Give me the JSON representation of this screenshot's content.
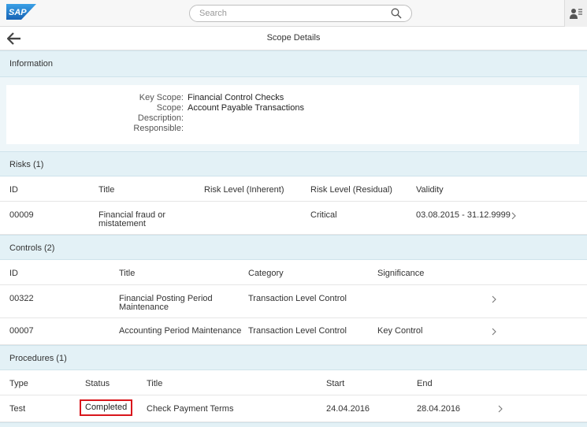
{
  "shell": {
    "logo_text": "SAP",
    "search_placeholder": "Search",
    "colors": {
      "logo": "#1e73be",
      "accent": "#e3f1f6",
      "highlight": "#d9161c"
    }
  },
  "page": {
    "title": "Scope Details"
  },
  "information": {
    "header": "Information",
    "fields": [
      {
        "label": "Key Scope:",
        "value": "Financial Control Checks"
      },
      {
        "label": "Scope:",
        "value": "Account Payable Transactions"
      },
      {
        "label": "Description:",
        "value": ""
      },
      {
        "label": "Responsible:",
        "value": ""
      }
    ]
  },
  "risks": {
    "header": "Risks (1)",
    "columns": [
      "ID",
      "Title",
      "Risk Level (Inherent)",
      "Risk Level (Residual)",
      "Validity"
    ],
    "rows": [
      {
        "id": "00009",
        "title_line1": "Financial fraud or",
        "title_line2": "mistatement",
        "inherent": "",
        "residual": "Critical",
        "validity": "03.08.2015 - 31.12.9999"
      }
    ]
  },
  "controls": {
    "header": "Controls (2)",
    "columns": [
      "ID",
      "Title",
      "Category",
      "Significance"
    ],
    "rows": [
      {
        "id": "00322",
        "title_line1": "Financial Posting Period",
        "title_line2": "Maintenance",
        "category": "Transaction Level Control",
        "significance": ""
      },
      {
        "id": "00007",
        "title_line1": "Accounting Period Maintenance",
        "title_line2": "",
        "category": "Transaction Level Control",
        "significance": "Key Control"
      }
    ]
  },
  "procedures": {
    "header": "Procedures (1)",
    "columns": [
      "Type",
      "Status",
      "Title",
      "Start",
      "End"
    ],
    "rows": [
      {
        "type": "Test",
        "status": "Completed",
        "title": "Check Payment Terms",
        "start": "24.04.2016",
        "end": "28.04.2016"
      }
    ]
  }
}
